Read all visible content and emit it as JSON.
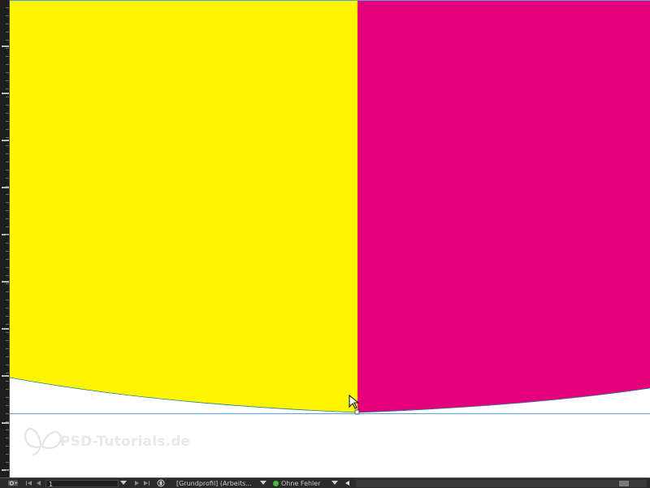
{
  "window": {
    "app": "InDesign",
    "document_preview": "layout-canvas"
  },
  "colors": {
    "yellow_shape": "#fff500",
    "magenta_shape": "#e4007a",
    "guide": "#5aa0e0",
    "statusbar_bg": "#2b2b2b",
    "preflight_ok": "#3fbf3f"
  },
  "watermark": {
    "text": "PSD-Tutorials.de"
  },
  "statusbar": {
    "page_number": "1",
    "profile": "[Grundprofil] (Arbeits...",
    "preflight_status": "Ohne Fehler",
    "icons": {
      "settings": "gear-icon",
      "first_page": "first-page-icon",
      "prev_page": "previous-page-icon",
      "page_menu": "chevron-down-icon",
      "next_page": "next-page-icon",
      "last_page": "last-page-icon",
      "open_page": "open-page-icon",
      "profile_menu": "chevron-down-icon",
      "preflight_menu": "chevron-down-icon",
      "scroll_left": "scroll-left-icon"
    }
  }
}
